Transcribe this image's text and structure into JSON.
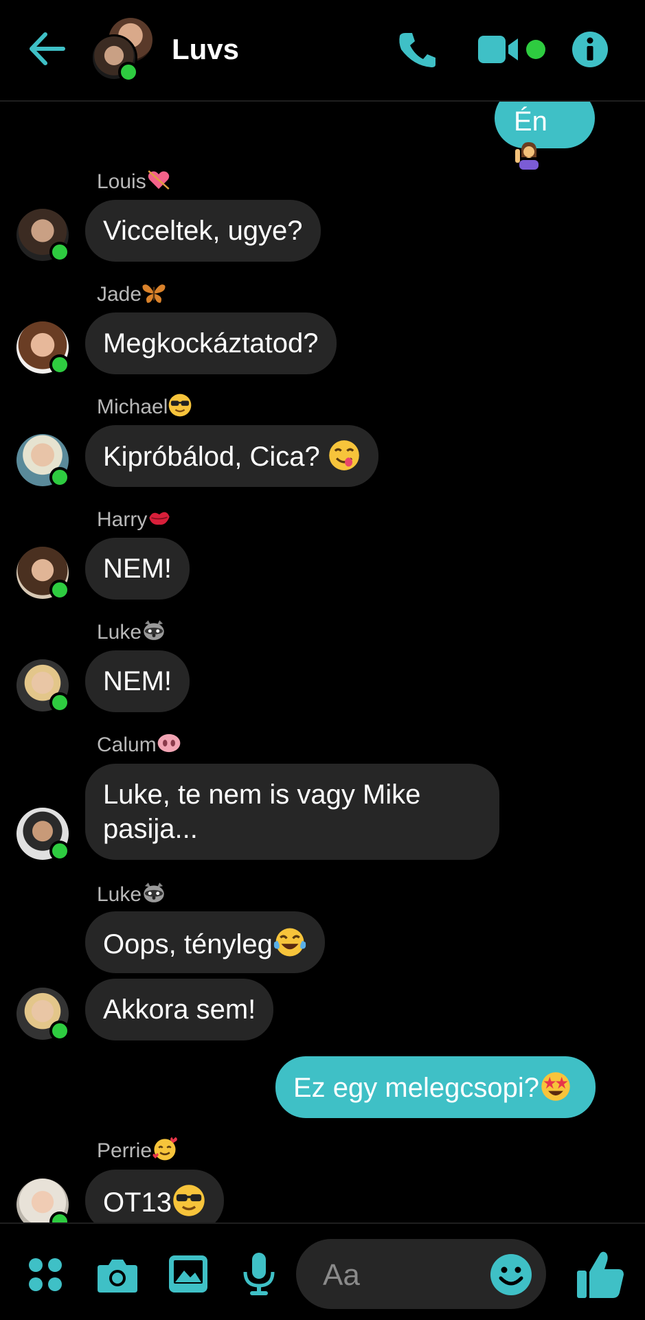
{
  "header": {
    "title": "Luvs"
  },
  "colors": {
    "accent": "#3fc0c6",
    "online": "#2ecc40",
    "bubble_other": "#262626",
    "background": "#000000"
  },
  "messages": {
    "en": "Én",
    "louis_name": "Louis",
    "louis_text": "Vicceltek, ugye?",
    "jade_name": "Jade",
    "jade_text": "Megkockáztatod?",
    "michael_name": "Michael",
    "michael_text": "Kipróbálod, Cica?",
    "harry_name": "Harry",
    "harry_text": "NEM!",
    "luke_name": "Luke",
    "luke_text": "NEM!",
    "calum_name": "Calum",
    "calum_text_1": "Luke, te nem is vagy Mike",
    "calum_text_2": "pasija...",
    "luke2_name": "Luke",
    "luke2_text_1": "Oops, tényleg",
    "luke2_text_2": "Akkora sem!",
    "mine_text": "Ez egy melegcsopi?",
    "perrie_name": "Perrie",
    "perrie_text": "OT13"
  },
  "composer": {
    "placeholder": "Aa"
  },
  "icons": [
    "back-arrow-icon",
    "phone-icon",
    "video-camera-icon",
    "info-icon",
    "apps-grid-icon",
    "camera-icon",
    "gallery-icon",
    "microphone-icon",
    "emoji-icon",
    "thumbs-up-icon"
  ]
}
